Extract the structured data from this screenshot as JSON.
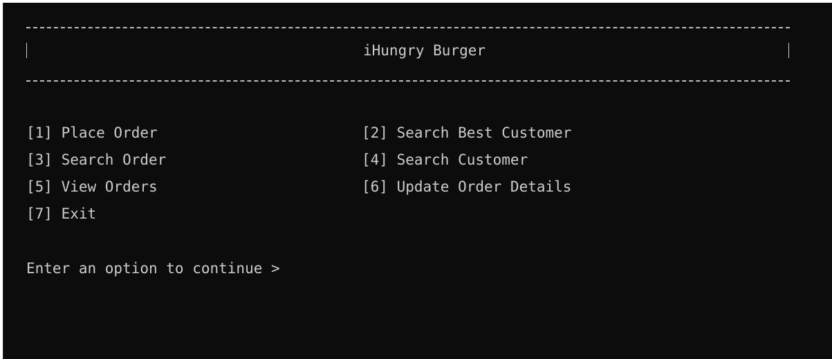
{
  "header": {
    "title": "iHungry Burger",
    "border_char": "|"
  },
  "menu": {
    "items": [
      {
        "label": "[1] Place Order"
      },
      {
        "label": "[2] Search Best Customer"
      },
      {
        "label": "[3] Search Order"
      },
      {
        "label": "[4] Search Customer"
      },
      {
        "label": "[5] View Orders"
      },
      {
        "label": "[6] Update Order Details"
      },
      {
        "label": "[7] Exit"
      }
    ]
  },
  "prompt": {
    "text": "Enter an option to continue >"
  },
  "colors": {
    "background": "#0c0c0c",
    "text": "#cccccc"
  }
}
